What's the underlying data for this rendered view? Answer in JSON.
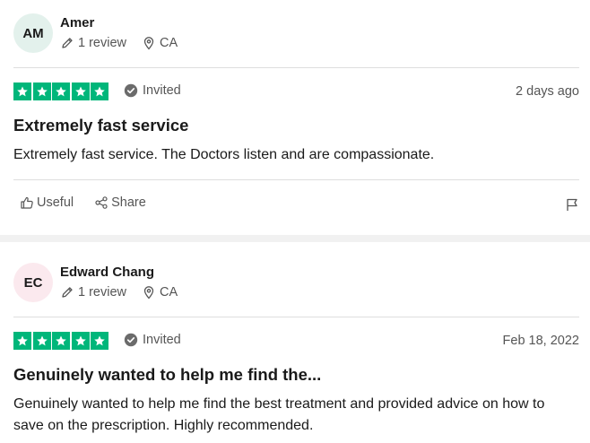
{
  "reviews": [
    {
      "initials": "AM",
      "name": "Amer",
      "review_count": "1 review",
      "country": "CA",
      "rating": 5,
      "verified_label": "Invited",
      "date": "2 days ago",
      "title": "Extremely fast service",
      "body": "Extremely fast service. The Doctors listen and are compassionate.",
      "useful_label": "Useful",
      "share_label": "Share"
    },
    {
      "initials": "EC",
      "name": "Edward Chang",
      "review_count": "1 review",
      "country": "CA",
      "rating": 5,
      "verified_label": "Invited",
      "date": "Feb 18, 2022",
      "title": "Genuinely wanted to help me find the...",
      "body": "Genuinely wanted to help me find the best treatment and provided advice on how to save on the prescription. Highly recommended."
    }
  ],
  "colors": {
    "star_green": "#00b67a",
    "avatar_1_bg": "#e3f1ec",
    "avatar_2_bg": "#fbe9ee"
  },
  "icons": [
    "pencil-icon",
    "location-pin-icon",
    "check-badge-icon",
    "star-icon",
    "thumbs-up-icon",
    "share-icon",
    "flag-icon"
  ]
}
